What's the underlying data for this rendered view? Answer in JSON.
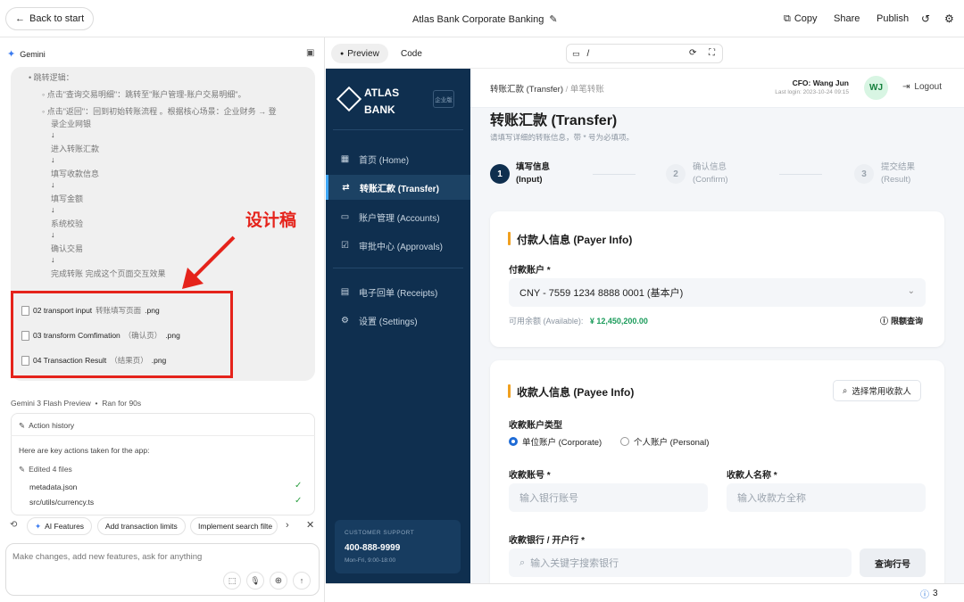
{
  "topbar": {
    "back_label": "Back to start",
    "title": "Atlas Bank Corporate Banking",
    "copy_label": "Copy",
    "share_label": "Share",
    "publish_label": "Publish"
  },
  "left": {
    "model_label": "Gemini",
    "bullet_heading": "跳转逻辑：",
    "sub1": "点击\"查询交易明细\"：跳转至\"账户管理-账户交易明细\"。",
    "sub2a": "点击\"返回\"：回到初始转账流程 。根据核心场景：企业财务 → 登",
    "sub2b": "录企业网银",
    "flow": [
      "进入转账汇款",
      "填写收款信息",
      "填写金额",
      "系统校验",
      "确认交易",
      "完成转账 完成这个页面交互效果"
    ],
    "arrow": "↓",
    "annotation": "设计稿",
    "files": [
      {
        "name": "02 transport input",
        "sub": "转账填写页面",
        "ext": ".png"
      },
      {
        "name": "03 transform Comfimation",
        "sub": "（确认页）",
        "ext": ".png"
      },
      {
        "name": "04 Transaction Result",
        "sub": "（结果页）",
        "ext": ".png"
      }
    ],
    "run_model": "Gemini 3 Flash Preview",
    "run_time": "Ran for 90s",
    "action_history": "Action history",
    "actions_intro": "Here are key actions taken for the app:",
    "edited": "Edited 4 files",
    "edited_files": [
      "metadata.json",
      "src/utils/currency.ts"
    ],
    "suggestions": [
      "AI Features",
      "Add transaction limits",
      "Implement search filte"
    ],
    "input_placeholder": "Make changes, add new features, ask for anything"
  },
  "preview": {
    "tab_preview": "Preview",
    "tab_code": "Code",
    "url": "/",
    "issues_count": "3"
  },
  "app": {
    "brand1": "ATLAS",
    "brand2": "BANK",
    "badge": "企业版",
    "nav": [
      {
        "label": "首页 (Home)",
        "icon": "▦"
      },
      {
        "label": "转账汇款 (Transfer)",
        "icon": "⇄"
      },
      {
        "label": "账户管理 (Accounts)",
        "icon": "▭"
      },
      {
        "label": "审批中心 (Approvals)",
        "icon": "☑"
      },
      {
        "label": "电子回单 (Receipts)",
        "icon": "▤"
      },
      {
        "label": "设置 (Settings)",
        "icon": "⚙"
      }
    ],
    "support_title": "CUSTOMER SUPPORT",
    "support_phone": "400-888-9999",
    "support_hours": "Mon-Fri, 9:00-18:00",
    "breadcrumb1": "转账汇款 (Transfer)",
    "breadcrumb2": "单笔转账",
    "user_name": "CFO: Wang Jun",
    "last_login": "Last login: 2023-10-24 09:15",
    "avatar": "WJ",
    "logout": "Logout",
    "page_title": "转账汇款 (Transfer)",
    "page_sub": "请填写详细的转账信息，带 * 号为必填项。",
    "steps": [
      {
        "num": "1",
        "l1": "填写信息",
        "l2": "(Input)"
      },
      {
        "num": "2",
        "l1": "确认信息",
        "l2": "(Confirm)"
      },
      {
        "num": "3",
        "l1": "提交结果",
        "l2": "(Result)"
      }
    ],
    "payer_title": "付款人信息 (Payer Info)",
    "payer_account_label": "付款账户 *",
    "payer_account_value": "CNY - 7559 1234 8888 0001 (基本户)",
    "balance_label": "可用余额 (Available):",
    "balance_value": "¥ 12,450,200.00",
    "limit_link": "限额查询",
    "payee_title": "收款人信息 (Payee Info)",
    "choose_payee": "选择常用收款人",
    "account_type_label": "收款账户类型",
    "type_corporate": "单位账户 (Corporate)",
    "type_personal": "个人账户 (Personal)",
    "account_no_label": "收款账号 *",
    "account_no_ph": "输入银行账号",
    "account_name_label": "收款人名称 *",
    "account_name_ph": "输入收款方全称",
    "bank_label": "收款银行 / 开户行 *",
    "bank_ph": "输入关键字搜索银行",
    "bank_query": "查询行号",
    "accent": "#f0a020",
    "primary": "#0f2f4f",
    "success": "#1a9b5a"
  }
}
